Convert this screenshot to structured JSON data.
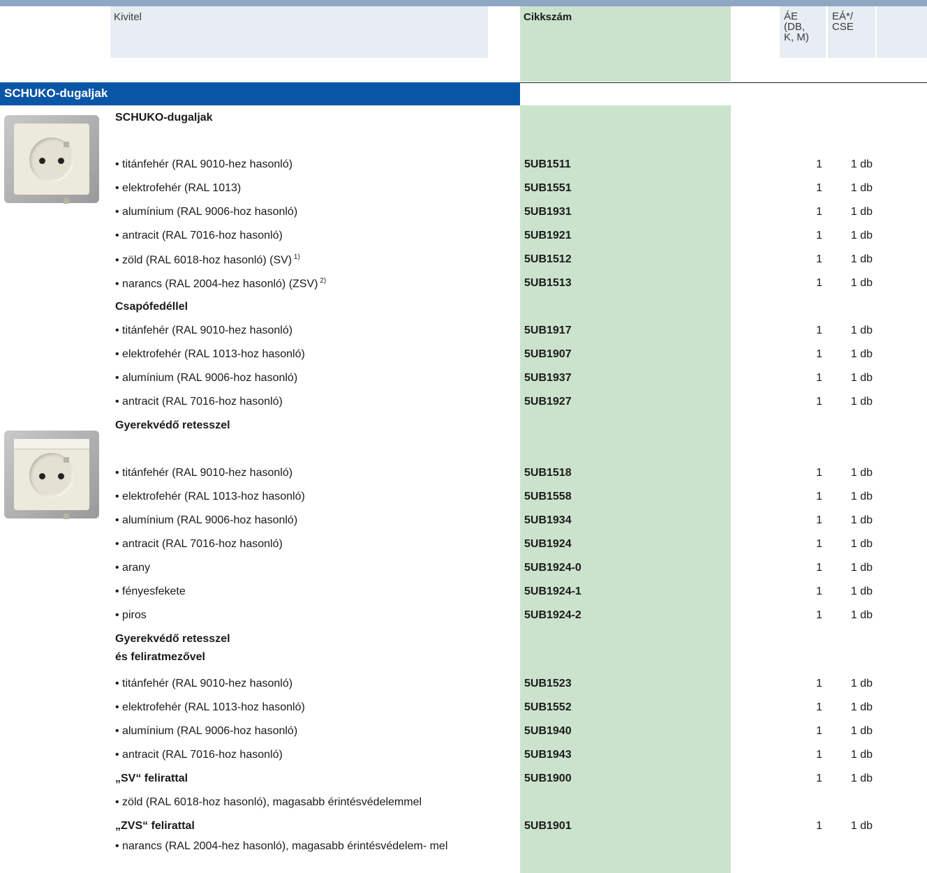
{
  "header": {
    "kivitel": "Kivitel",
    "cikkszam": "Cikkszám",
    "ae": "ÁE\n(DB,\nK, M)",
    "ea": "EÁ*/\nCSE"
  },
  "section": {
    "title": "SCHUKO-dugaljak"
  },
  "rows": [
    {
      "text": "SCHUKO-dugaljak",
      "sub": true,
      "code": "",
      "ae": "",
      "ea": ""
    },
    {
      "text": "• titánfehér (RAL 9010-hez hasonló)",
      "code": "5UB1511",
      "ae": "1",
      "ea": "1 db"
    },
    {
      "text": "• elektrofehér (RAL 1013)",
      "code": "5UB1551",
      "ae": "1",
      "ea": "1 db"
    },
    {
      "text": "• alumínium (RAL 9006-hoz hasonló)",
      "code": "5UB1931",
      "ae": "1",
      "ea": "1 db"
    },
    {
      "text": "• antracit (RAL 7016-hoz hasonló)",
      "code": "5UB1921",
      "ae": "1",
      "ea": "1 db"
    },
    {
      "text": "• zöld (RAL 6018-hoz hasonló) (SV)",
      "sup": "1)",
      "code": "5UB1512",
      "ae": "1",
      "ea": "1 db"
    },
    {
      "text": "• narancs (RAL 2004-hez hasonló) (ZSV)",
      "sup": "2)",
      "code": "5UB1513",
      "ae": "1",
      "ea": "1 db"
    },
    {
      "text": "Csapófedéllel",
      "sub": true,
      "code": "",
      "ae": "",
      "ea": ""
    },
    {
      "text": "• titánfehér (RAL 9010-hez hasonló)",
      "code": "5UB1917",
      "ae": "1",
      "ea": "1 db"
    },
    {
      "text": "• elektrofehér (RAL 1013-hoz hasonló)",
      "code": "5UB1907",
      "ae": "1",
      "ea": "1 db"
    },
    {
      "text": "• alumínium (RAL 9006-hoz hasonló)",
      "code": "5UB1937",
      "ae": "1",
      "ea": "1 db"
    },
    {
      "text": "• antracit (RAL 7016-hoz hasonló)",
      "code": "5UB1927",
      "ae": "1",
      "ea": "1 db"
    },
    {
      "text": "Gyerekvédő retesszel",
      "sub": true,
      "code": "",
      "ae": "",
      "ea": ""
    },
    {
      "text": "• titánfehér (RAL 9010-hez hasonló)",
      "code": "5UB1518",
      "ae": "1",
      "ea": "1 db"
    },
    {
      "text": "• elektrofehér (RAL 1013-hoz hasonló)",
      "code": "5UB1558",
      "ae": "1",
      "ea": "1 db"
    },
    {
      "text": "• alumínium (RAL 9006-hoz hasonló)",
      "code": "5UB1934",
      "ae": "1",
      "ea": "1 db"
    },
    {
      "text": "• antracit (RAL 7016-hoz hasonló)",
      "code": "5UB1924",
      "ae": "1",
      "ea": "1 db"
    },
    {
      "text": "• arany",
      "code": "5UB1924-0",
      "ae": "1",
      "ea": "1 db"
    },
    {
      "text": "• fényesfekete",
      "code": "5UB1924-1",
      "ae": "1",
      "ea": "1 db"
    },
    {
      "text": "• piros",
      "code": "5UB1924-2",
      "ae": "1",
      "ea": "1 db"
    },
    {
      "text": "Gyerekvédő retesszel",
      "sub": true,
      "code": "",
      "ae": "",
      "ea": ""
    },
    {
      "text": "és feliratmezővel",
      "sub": true,
      "code": "",
      "ae": "",
      "ea": ""
    },
    {
      "text": "• titánfehér (RAL 9010-hez hasonló)",
      "code": "5UB1523",
      "ae": "1",
      "ea": "1 db"
    },
    {
      "text": "• elektrofehér (RAL 1013-hoz hasonló)",
      "code": "5UB1552",
      "ae": "1",
      "ea": "1 db"
    },
    {
      "text": "• alumínium (RAL 9006-hoz hasonló)",
      "code": "5UB1940",
      "ae": "1",
      "ea": "1 db"
    },
    {
      "text": "• antracit (RAL 7016-hoz hasonló)",
      "code": "5UB1943",
      "ae": "1",
      "ea": "1 db"
    },
    {
      "text": "„SV“ felirattal",
      "sub": true,
      "code": "5UB1900",
      "ae": "1",
      "ea": "1 db"
    },
    {
      "text": "• zöld (RAL 6018-hoz hasonló), magasabb érintésvédelemmel",
      "code": "",
      "ae": "",
      "ea": ""
    },
    {
      "text": "„ZVS“ felirattal",
      "sub": true,
      "code": "5UB1901",
      "ae": "1",
      "ea": "1 db"
    },
    {
      "text": "• narancs (RAL 2004-hez hasonló), magasabb érintésvédelem-\nmel",
      "code": "",
      "ae": "",
      "ea": ""
    }
  ],
  "images": [
    {
      "name": "schuko-socket-image",
      "lid": false
    },
    {
      "name": "schuko-socket-child-protection-image",
      "lid": true
    }
  ]
}
